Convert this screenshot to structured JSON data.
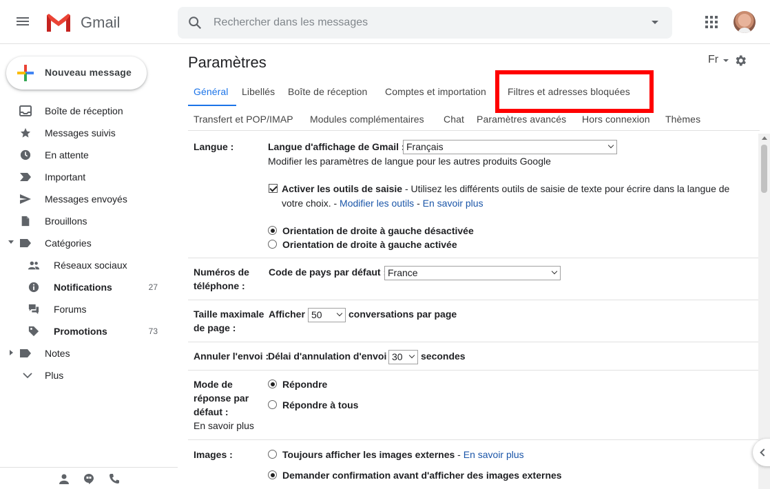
{
  "header": {
    "app_name": "Gmail",
    "search_placeholder": "Rechercher dans les messages"
  },
  "sidebar": {
    "compose_label": "Nouveau message",
    "items": [
      {
        "label": "Boîte de réception",
        "icon": "inbox-icon"
      },
      {
        "label": "Messages suivis",
        "icon": "star-icon"
      },
      {
        "label": "En attente",
        "icon": "clock-icon"
      },
      {
        "label": "Important",
        "icon": "important-icon"
      },
      {
        "label": "Messages envoyés",
        "icon": "send-icon"
      },
      {
        "label": "Brouillons",
        "icon": "draft-icon"
      },
      {
        "label": "Catégories",
        "icon": "label-icon"
      },
      {
        "label": "Réseaux sociaux",
        "icon": "people-icon"
      },
      {
        "label": "Notifications",
        "icon": "info-icon",
        "count": "27"
      },
      {
        "label": "Forums",
        "icon": "forum-icon"
      },
      {
        "label": "Promotions",
        "icon": "tag-icon",
        "count": "73"
      },
      {
        "label": "Notes",
        "icon": "label-icon"
      },
      {
        "label": "Plus",
        "icon": "chevron-down-icon"
      }
    ]
  },
  "main": {
    "title": "Paramètres",
    "lang_switch": "Fr",
    "tabs_row1": [
      "Général",
      "Libellés",
      "Boîte de réception",
      "Comptes et importation",
      "Filtres et adresses bloquées"
    ],
    "tabs_row2": [
      "Transfert et POP/IMAP",
      "Modules complémentaires",
      "Chat",
      "Paramètres avancés",
      "Hors connexion",
      "Thèmes"
    ],
    "active_tab": "Général",
    "settings": {
      "langue": {
        "label": "Langue :",
        "display_label": "Langue d'affichage de Gmail :",
        "display_value": "Français",
        "other_products_link": "Modifier les paramètres de langue pour les autres produits Google",
        "input_tools_label": "Activer les outils de saisie",
        "input_tools_desc1": " - Utilisez les différents outils de saisie de texte pour écrire dans la langue de",
        "input_tools_desc2": "votre choix. - ",
        "modify_tools_link": "Modifier les outils",
        "sep": " - ",
        "learn_more": "En savoir plus",
        "rtl_off": "Orientation de droite à gauche désactivée",
        "rtl_on": "Orientation de droite à gauche activée"
      },
      "phone": {
        "label1": "Numéros de",
        "label2": "téléphone :",
        "country_label": "Code de pays par défaut :",
        "country_value": "France"
      },
      "page_size": {
        "label1": "Taille maximale",
        "label2": "de page :",
        "show": "Afficher",
        "value": "50",
        "suffix": "conversations par page"
      },
      "undo_send": {
        "label": "Annuler l'envoi :",
        "delay_label": "Délai d'annulation d'envoi :",
        "value": "30",
        "suffix": "secondes"
      },
      "reply_mode": {
        "label1": "Mode de",
        "label2": "réponse par",
        "label3": "défaut :",
        "learn_more": "En savoir plus",
        "reply": "Répondre",
        "reply_all": "Répondre à tous"
      },
      "images": {
        "label": "Images :",
        "always": "Toujours afficher les images externes",
        "sep": " - ",
        "learn_more": "En savoir plus",
        "ask": "Demander confirmation avant d'afficher des images externes"
      }
    }
  },
  "colors": {
    "accent": "#1a73e8",
    "link": "#1a55a8",
    "highlight": "#ff0000"
  }
}
